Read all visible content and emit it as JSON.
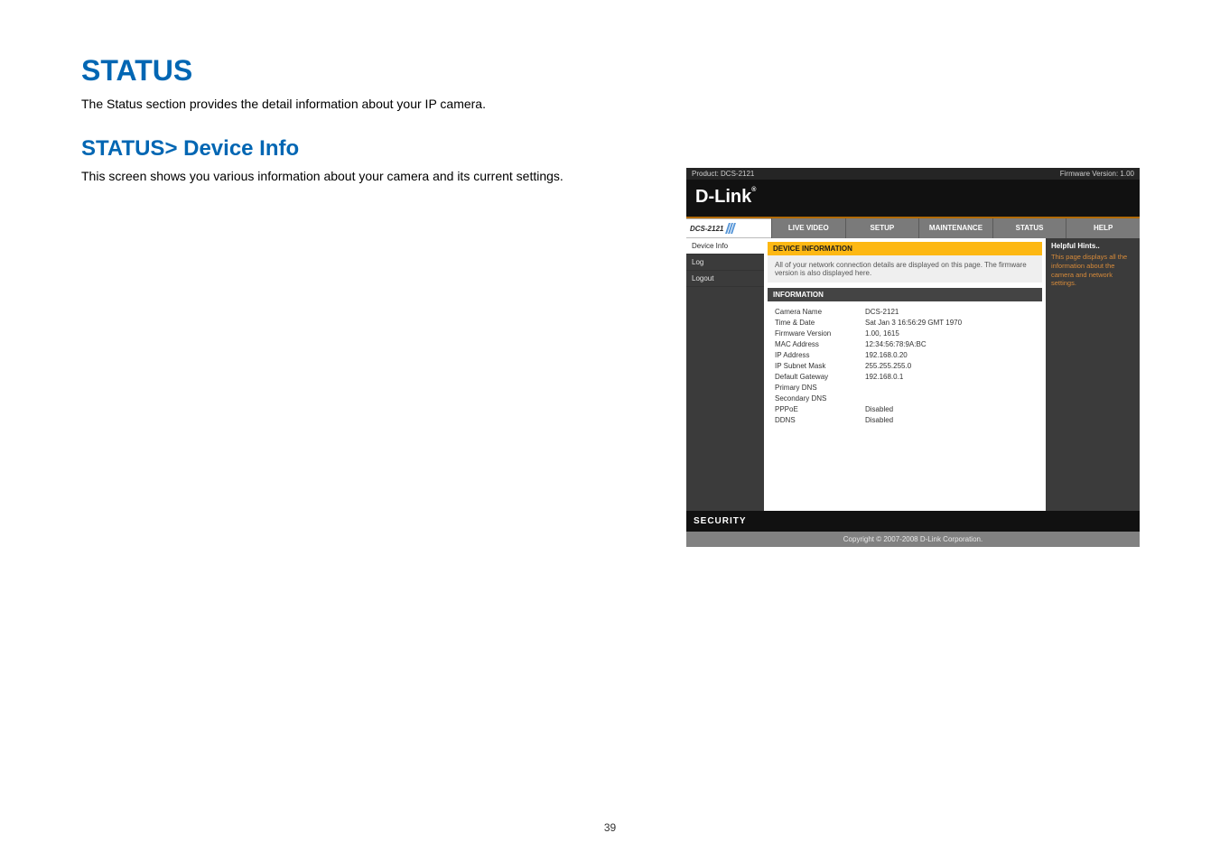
{
  "doc": {
    "title": "STATUS",
    "intro": "The Status section provides the detail information about your IP camera.",
    "subtitle": "STATUS> Device Info",
    "desc": "This screen shows you various information about your camera and its current settings.",
    "page_number": "39"
  },
  "ui": {
    "topbar": {
      "product": "Product: DCS-2121",
      "fw": "Firmware Version: 1.00"
    },
    "brand": "D-Link",
    "model": "DCS-2121",
    "tabs": {
      "live": "LIVE VIDEO",
      "setup": "SETUP",
      "maintenance": "MAINTENANCE",
      "status": "STATUS",
      "help": "HELP"
    },
    "sidebar": {
      "device_info": "Device Info",
      "log": "Log",
      "logout": "Logout"
    },
    "devinfo": {
      "header": "DEVICE INFORMATION",
      "text": "All of your network connection details are displayed on this page. The firmware version is also displayed here."
    },
    "infohdr": "INFORMATION",
    "info": {
      "rows": [
        {
          "k": "Camera Name",
          "v": "DCS-2121"
        },
        {
          "k": "Time & Date",
          "v": "Sat Jan 3 16:56:29 GMT 1970"
        },
        {
          "k": "Firmware Version",
          "v": "1.00, 1615"
        },
        {
          "k": "MAC Address",
          "v": "12:34:56:78:9A:BC"
        },
        {
          "k": "IP Address",
          "v": "192.168.0.20"
        },
        {
          "k": "IP Subnet Mask",
          "v": "255.255.255.0"
        },
        {
          "k": "Default Gateway",
          "v": "192.168.0.1"
        },
        {
          "k": "Primary DNS",
          "v": ""
        },
        {
          "k": "Secondary DNS",
          "v": ""
        },
        {
          "k": "PPPoE",
          "v": "Disabled"
        },
        {
          "k": "DDNS",
          "v": "Disabled"
        }
      ]
    },
    "help": {
      "header": "Helpful Hints..",
      "text": "This page displays all the information about the camera and network settings."
    },
    "security": "SECURITY",
    "copyright": "Copyright © 2007-2008 D-Link Corporation."
  }
}
